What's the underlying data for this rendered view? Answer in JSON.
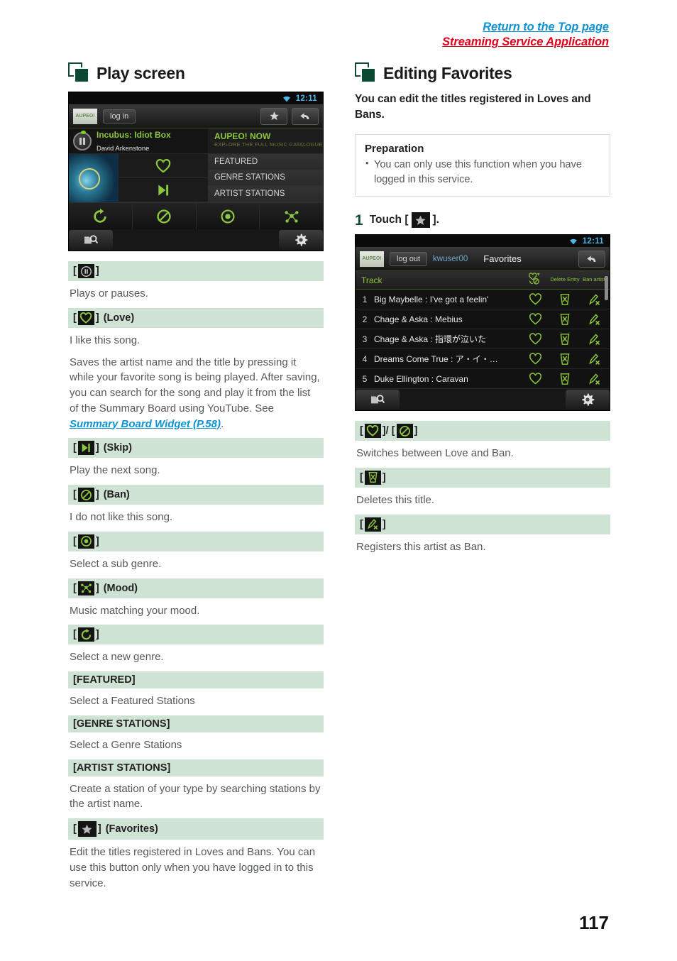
{
  "header": {
    "link_top": "Return to the Top page",
    "link_app": "Streaming Service Application"
  },
  "page_number": "117",
  "left": {
    "section_title": "Play screen",
    "device": {
      "status_time": "12:11",
      "logo_label": "AUPEO!",
      "login_button": "log in",
      "now_playing_title": "Incubus: Idiot Box",
      "now_playing_artist": "David Arkenstone",
      "promo_title": "AUPEO! NOW",
      "promo_subtitle": "EXPLORE THE FULL MUSIC CATALOGUE",
      "menu": [
        "FEATURED",
        "GENRE STATIONS",
        "ARTIST STATIONS"
      ]
    },
    "entries": [
      {
        "icon": "pause",
        "term_suffix": "",
        "desc": [
          "Plays or pauses."
        ]
      },
      {
        "icon": "heart",
        "term_suffix": "(Love)",
        "desc": [
          "I like this song."
        ]
      },
      {
        "icon": "skip",
        "term_suffix": "(Skip)",
        "desc": [
          "Play the next song."
        ]
      },
      {
        "icon": "ban",
        "term_suffix": "(Ban)",
        "desc": [
          "I do not like this song."
        ]
      },
      {
        "icon": "target",
        "term_suffix": "",
        "desc": [
          "Select a sub genre."
        ]
      },
      {
        "icon": "mood",
        "term_suffix": "(Mood)",
        "desc": [
          "Music matching your mood."
        ]
      },
      {
        "icon": "refresh",
        "term_suffix": "",
        "desc": [
          "Select a new genre."
        ]
      }
    ],
    "love_desc_1": "I like this song.",
    "love_desc_2_a": "Saves the artist name and the title by pressing it while your favorite song is being played. After saving, you can search for the song and play it from the list of the Summary Board using YouTube. See ",
    "love_link": "Summary Board Widget (P.58)",
    "love_desc_2_b": ".",
    "text_terms": [
      {
        "term": "[FEATURED]",
        "desc": "Select a Featured Stations"
      },
      {
        "term": "[GENRE STATIONS]",
        "desc": "Select a Genre Stations"
      },
      {
        "term": "[ARTIST STATIONS]",
        "desc": "Create a station of your type by searching stations by the artist name."
      }
    ],
    "favorites_term_suffix": "(Favorites)",
    "favorites_desc": "Edit the titles registered in Loves and Bans. You can use this button only when you have logged in to this service."
  },
  "right": {
    "section_title": "Editing Favorites",
    "intro": "You can edit the titles registered in Loves and Bans.",
    "preparation": {
      "title": "Preparation",
      "items": [
        "You can only use this function when you have logged in this service."
      ]
    },
    "step": {
      "number": "1",
      "text_before": "Touch [",
      "text_after": "]."
    },
    "device": {
      "status_time": "12:11",
      "logo_label": "AUPEO!",
      "logout_button": "log out",
      "user": "kwuser00",
      "screen_title": "Favorites",
      "col_track": "Track",
      "col_delete": "Delete Entry",
      "col_ban": "Ban artist.",
      "rows": [
        {
          "num": "1",
          "title": "Big Maybelle : I've got a feelin'"
        },
        {
          "num": "2",
          "title": "Chage & Aska : Mebius"
        },
        {
          "num": "3",
          "title": "Chage & Aska : 指環が泣いた"
        },
        {
          "num": "4",
          "title": "Dreams Come True : ア・イ・…"
        },
        {
          "num": "5",
          "title": "Duke Ellington : Caravan"
        }
      ]
    },
    "entries": [
      {
        "icons": [
          "heart",
          "ban"
        ],
        "desc": "Switches between Love and Ban."
      },
      {
        "icons": [
          "trash"
        ],
        "desc": "Deletes this title."
      },
      {
        "icons": [
          "banartist"
        ],
        "desc": "Registers this artist as Ban."
      }
    ]
  },
  "colors": {
    "accent_green": "#8dc63f",
    "dark_green": "#0d4a33",
    "term_bg": "#cfe3d4",
    "link_blue": "#0d93d2",
    "link_red": "#e2001a"
  }
}
